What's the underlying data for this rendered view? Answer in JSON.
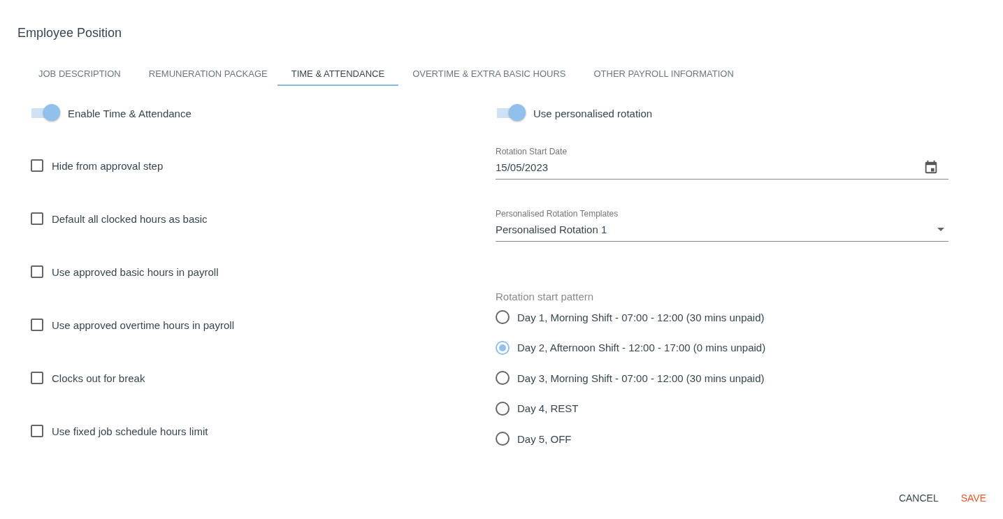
{
  "window": {
    "title": "Employee Position"
  },
  "tabs": [
    {
      "label": "JOB DESCRIPTION",
      "selected": false
    },
    {
      "label": "REMUNERATION PACKAGE",
      "selected": false
    },
    {
      "label": "TIME & ATTENDANCE",
      "selected": true
    },
    {
      "label": "OVERTIME & EXTRA BASIC HOURS",
      "selected": false
    },
    {
      "label": "OTHER PAYROLL INFORMATION",
      "selected": false
    }
  ],
  "left": {
    "toggle": {
      "label": "Enable Time & Attendance",
      "on": true
    },
    "checkboxes": [
      {
        "label": "Hide from approval step",
        "checked": false
      },
      {
        "label": "Default all clocked hours as basic",
        "checked": false
      },
      {
        "label": "Use approved basic hours in payroll",
        "checked": false
      },
      {
        "label": "Use approved overtime hours in payroll",
        "checked": false
      },
      {
        "label": "Clocks out for break",
        "checked": false
      },
      {
        "label": "Use fixed job schedule hours limit",
        "checked": false
      }
    ]
  },
  "right": {
    "toggle": {
      "label": "Use personalised rotation",
      "on": true
    },
    "date_field": {
      "label": "Rotation Start Date",
      "value": "15/05/2023"
    },
    "template_select": {
      "label": "Personalised Rotation Templates",
      "value": "Personalised Rotation 1"
    },
    "pattern": {
      "label": "Rotation start pattern",
      "options": [
        {
          "label": "Day 1, Morning Shift - 07:00 - 12:00 (30 mins unpaid)",
          "selected": false
        },
        {
          "label": "Day 2, Afternoon Shift - 12:00 - 17:00 (0 mins unpaid)",
          "selected": true
        },
        {
          "label": "Day 3, Morning Shift - 07:00 - 12:00 (30 mins unpaid)",
          "selected": false
        },
        {
          "label": "Day 4, REST",
          "selected": false
        },
        {
          "label": "Day 5, OFF",
          "selected": false
        }
      ]
    }
  },
  "buttons": [
    {
      "label": "CANCEL",
      "kind": "secondary"
    },
    {
      "label": "SAVE",
      "kind": "primary"
    }
  ]
}
